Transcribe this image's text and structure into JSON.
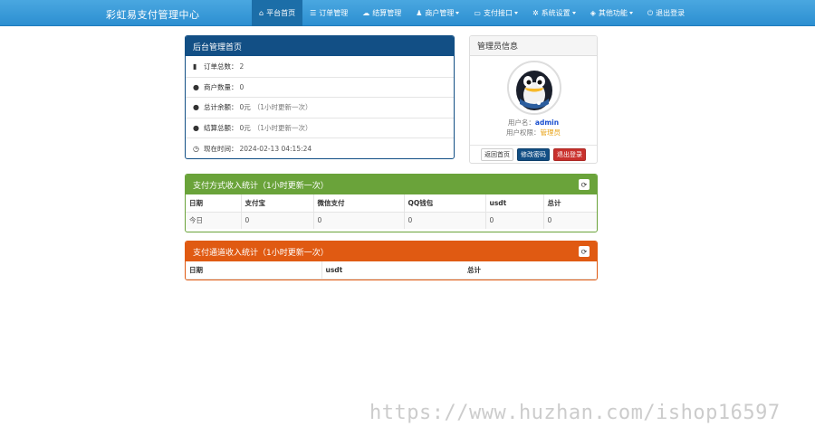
{
  "navbar": {
    "brand": "彩虹易支付管理中心",
    "items": [
      {
        "label": "平台首页",
        "icon": "home-icon",
        "glyph": "⌂",
        "active": true,
        "dropdown": false
      },
      {
        "label": "订单管理",
        "icon": "list-icon",
        "glyph": "☰",
        "active": false,
        "dropdown": false
      },
      {
        "label": "结算管理",
        "icon": "cloud-icon",
        "glyph": "☁",
        "active": false,
        "dropdown": false
      },
      {
        "label": "商户管理",
        "icon": "user-icon",
        "glyph": "♟",
        "active": false,
        "dropdown": true
      },
      {
        "label": "支付接口",
        "icon": "credit-card-icon",
        "glyph": "▭",
        "active": false,
        "dropdown": true
      },
      {
        "label": "系统设置",
        "icon": "gear-icon",
        "glyph": "✲",
        "active": false,
        "dropdown": true
      },
      {
        "label": "其他功能",
        "icon": "cube-icon",
        "glyph": "◈",
        "active": false,
        "dropdown": true
      },
      {
        "label": "退出登录",
        "icon": "power-icon",
        "glyph": "⏻",
        "active": false,
        "dropdown": false
      }
    ]
  },
  "home_panel": {
    "title": "后台管理首页",
    "items": [
      {
        "icon": "bar-chart-icon",
        "glyph": "▮",
        "label": "订单总数：",
        "value": "2",
        "note": ""
      },
      {
        "icon": "drop-icon",
        "glyph": "●",
        "label": "商户数量：",
        "value": "0",
        "note": ""
      },
      {
        "icon": "drop-icon",
        "glyph": "●",
        "label": "总计余额：",
        "value": "0元",
        "note": "（1小时更新一次）"
      },
      {
        "icon": "drop-icon",
        "glyph": "●",
        "label": "结算总额：",
        "value": "0元",
        "note": "（1小时更新一次）"
      },
      {
        "icon": "clock-icon",
        "glyph": "◷",
        "label": "现在时间：",
        "value": "2024-02-13 04:15:24",
        "note": ""
      }
    ]
  },
  "admin_panel": {
    "title": "管理员信息",
    "username_label": "用户名：",
    "username": "admin",
    "role_label": "用户权限：",
    "role": "管理员",
    "buttons": {
      "home": "返回首页",
      "change_password": "修改密码",
      "logout": "退出登录"
    }
  },
  "pay_type_panel": {
    "title": "支付方式收入统计（1小时更新一次）",
    "columns": [
      "日期",
      "支付宝",
      "微信支付",
      "QQ钱包",
      "usdt",
      "总计"
    ],
    "rows": [
      [
        "今日",
        "0",
        "0",
        "0",
        "0",
        "0"
      ]
    ]
  },
  "channel_panel": {
    "title": "支付通道收入统计（1小时更新一次）",
    "columns": [
      "日期",
      "usdt",
      "总计"
    ]
  },
  "watermark": "https://www.huzhan.com/ishop16597",
  "colors": {
    "navbar": "#2c8fd1",
    "panel_blue": "#124f85",
    "panel_green": "#6aa33a",
    "panel_orange": "#e05a12"
  }
}
